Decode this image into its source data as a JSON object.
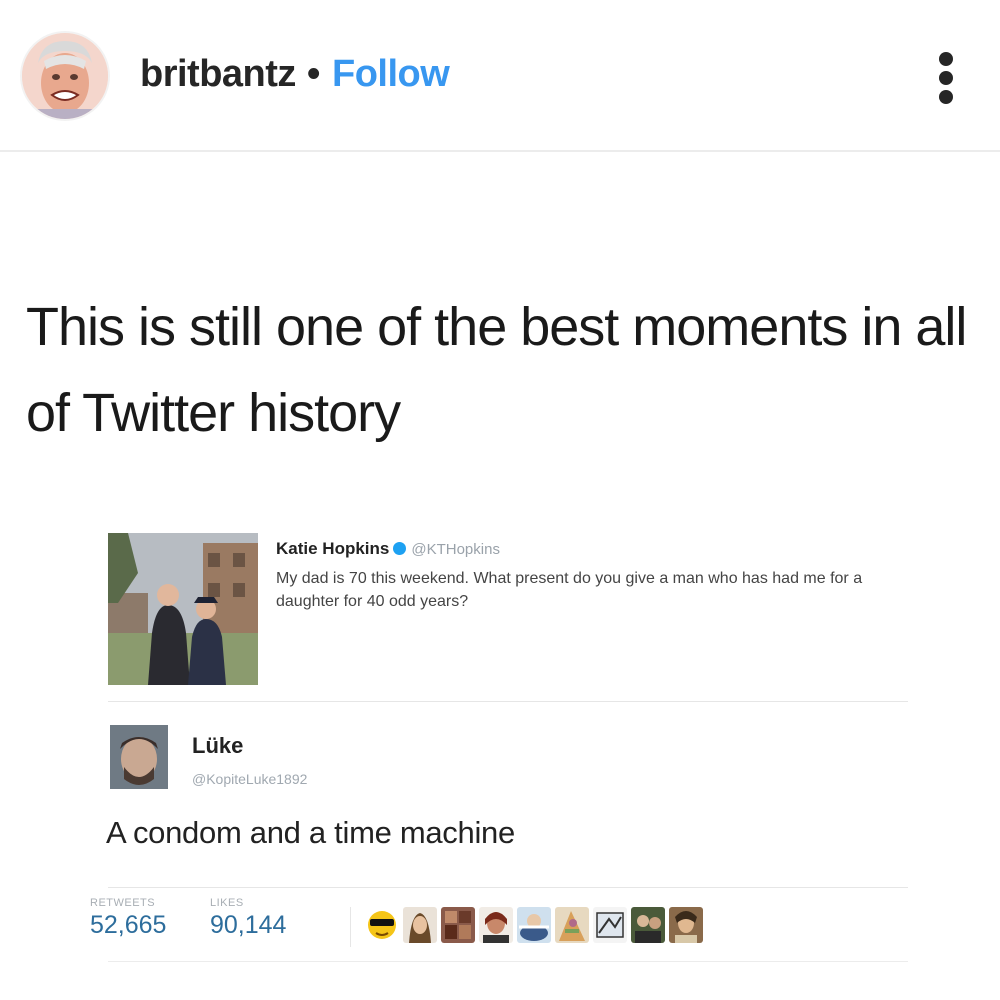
{
  "header": {
    "username": "britbantz",
    "separator": "•",
    "follow_label": "Follow",
    "more_icon": "more-vertical-icon",
    "follow_color": "#3897f0"
  },
  "post": {
    "caption": "This is still one of the best moments in all of Twitter history"
  },
  "tweet": {
    "author_name": "Katie Hopkins",
    "author_handle": "@KTHopkins",
    "text": "My dad is 70 this weekend. What present do you give a man who has had me for a daughter for 40 odd years?",
    "verified_icon": "verified-badge-icon"
  },
  "reply": {
    "author_name": "Lüke",
    "author_handle": "@KopiteLuke1892",
    "text": "A condom and a time machine",
    "retweets_label": "RETWEETS",
    "retweets_count": "52,665",
    "likes_label": "LIKES",
    "likes_count": "90,144"
  }
}
